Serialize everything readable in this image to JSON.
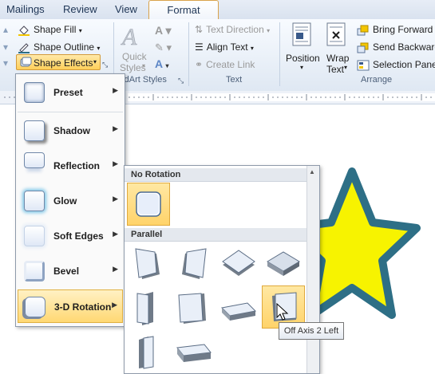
{
  "tabs": [
    {
      "label": "Mailings"
    },
    {
      "label": "Review"
    },
    {
      "label": "View"
    },
    {
      "label": "Format"
    }
  ],
  "ribbon": {
    "shape_styles": {
      "fill_label": "Shape Fill",
      "outline_label": "Shape Outline",
      "effects_label": "Shape Effects"
    },
    "wordart": {
      "quick_styles_line1": "Quick",
      "quick_styles_line2": "Styles",
      "group_label": "rdArt Styles"
    },
    "text": {
      "direction_label": "Text Direction",
      "align_label": "Align Text",
      "link_label": "Create Link",
      "group_label": "Text"
    },
    "arrange": {
      "position_label": "Position",
      "wrap_line1": "Wrap",
      "wrap_line2": "Text",
      "bring_forward": "Bring Forward",
      "send_backward": "Send Backward",
      "selection_pane": "Selection Pane",
      "group_label": "Arrange"
    }
  },
  "effects_menu": {
    "items": [
      {
        "label": "Preset"
      },
      {
        "label": "Shadow"
      },
      {
        "label": "Reflection"
      },
      {
        "label": "Glow"
      },
      {
        "label": "Soft Edges"
      },
      {
        "label": "Bevel"
      },
      {
        "label": "3-D Rotation"
      }
    ],
    "active": "3-D Rotation"
  },
  "gallery": {
    "sections": [
      {
        "title": "No Rotation"
      },
      {
        "title": "Parallel"
      }
    ],
    "hovered": "Off Axis 2 Left"
  },
  "tooltip": "Off Axis 2 Left",
  "colors": {
    "star_fill": "#f7f300",
    "star_outline": "#2e6f86",
    "highlight": "#ffd873",
    "accent_border": "#e0a93c"
  }
}
